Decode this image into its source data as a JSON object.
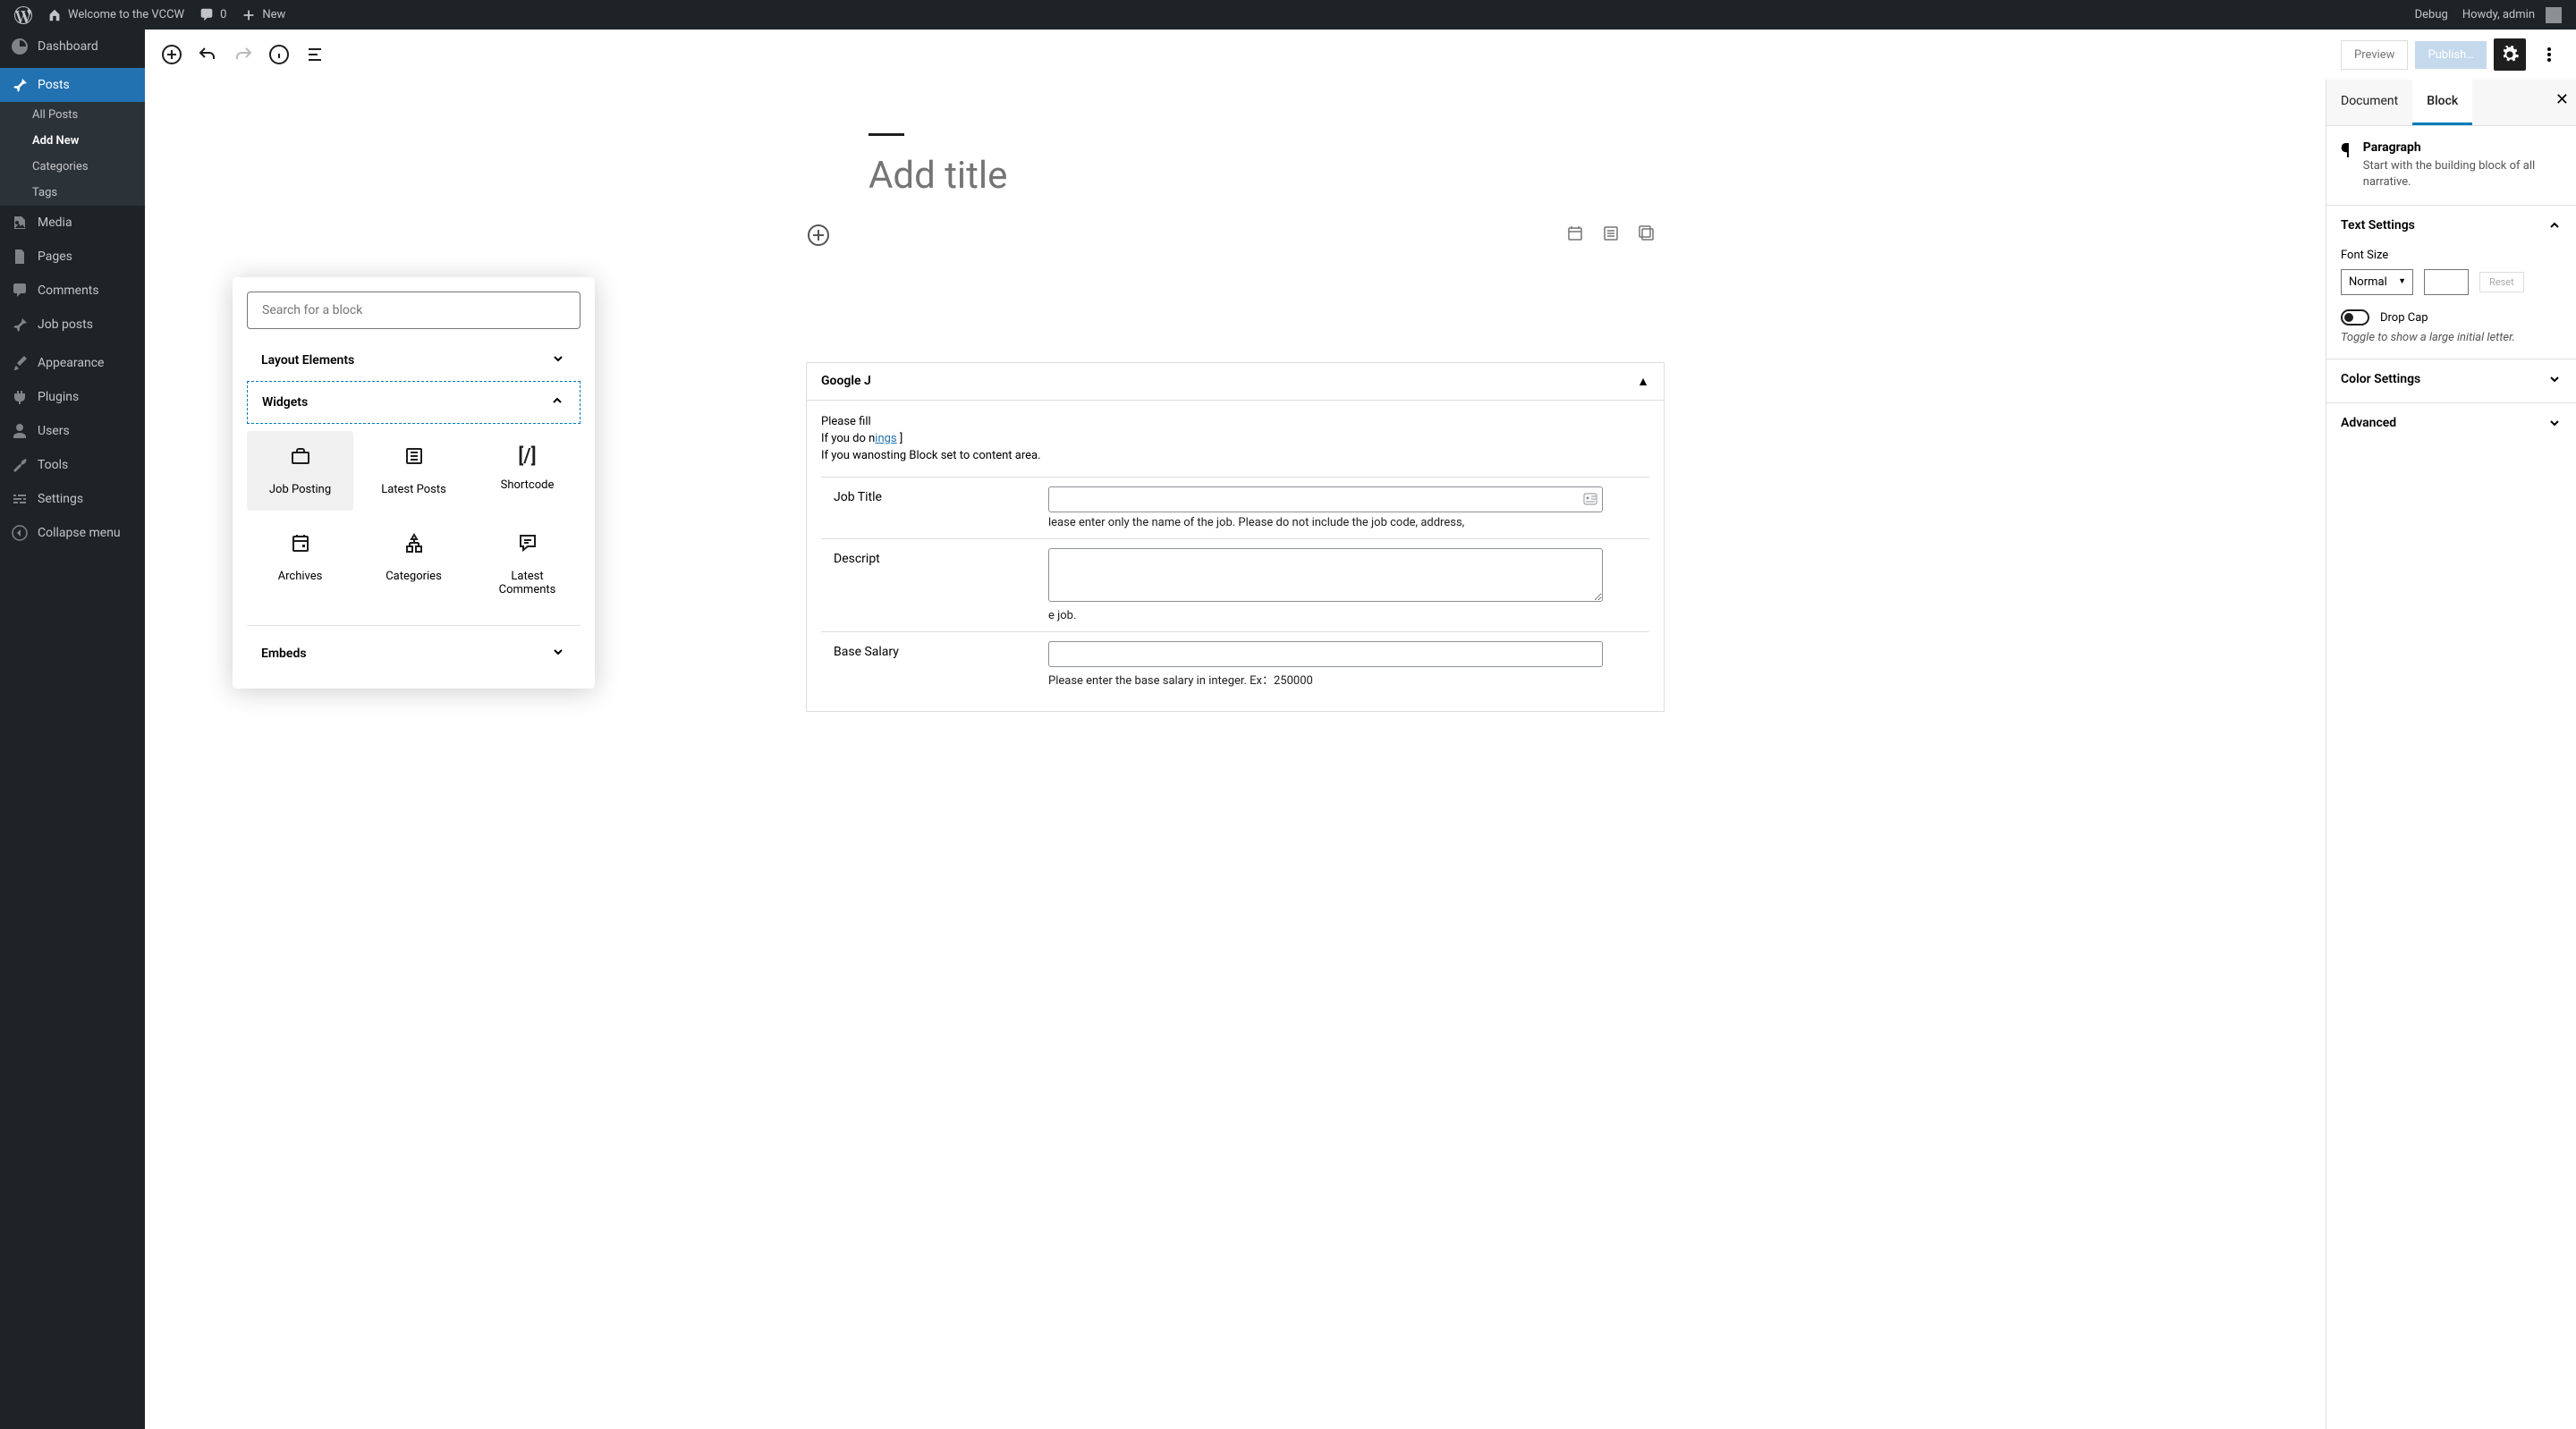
{
  "adminBar": {
    "siteName": "Welcome to the VCCW",
    "commentCount": "0",
    "new": "New",
    "debug": "Debug",
    "greeting": "Howdy, admin"
  },
  "sidebar": {
    "dashboard": "Dashboard",
    "posts": "Posts",
    "allPosts": "All Posts",
    "addNew": "Add New",
    "categories": "Categories",
    "tags": "Tags",
    "media": "Media",
    "pages": "Pages",
    "comments": "Comments",
    "jobPosts": "Job posts",
    "appearance": "Appearance",
    "plugins": "Plugins",
    "users": "Users",
    "tools": "Tools",
    "settings": "Settings",
    "collapse": "Collapse menu"
  },
  "toolbar": {
    "preview": "Preview",
    "publish": "Publish…"
  },
  "editor": {
    "titlePlaceholder": "Add title"
  },
  "inserter": {
    "searchPlaceholder": "Search for a block",
    "catLayout": "Layout Elements",
    "catWidgets": "Widgets",
    "catEmbeds": "Embeds",
    "blocks": {
      "jobPosting": "Job Posting",
      "latestPosts": "Latest Posts",
      "shortcode": "Shortcode",
      "archives": "Archives",
      "categories": "Categories",
      "latestComments": "Latest Comments"
    }
  },
  "metabox": {
    "title": "Google J",
    "p1": "Please fill",
    "p2a": "If you do n",
    "p2link": "ings",
    "p2b": " ]",
    "p3": "If you wan",
    "p3b": "osting Block set to content area.",
    "jobTitle": "Job Title",
    "jobTitleHint": "lease enter only the name of the job. Please do not include the job code, address,",
    "description": "Descript",
    "descriptionHint": "e job.",
    "baseSalary": "Base Salary",
    "baseSalaryHint": "Please enter the base salary in integer. Ex：250000"
  },
  "panel": {
    "tabDocument": "Document",
    "tabBlock": "Block",
    "blockName": "Paragraph",
    "blockDesc": "Start with the building block of all narrative.",
    "textSettings": "Text Settings",
    "fontSize": "Font Size",
    "fontSizeValue": "Normal",
    "reset": "Reset",
    "dropCap": "Drop Cap",
    "dropCapHint": "Toggle to show a large initial letter.",
    "colorSettings": "Color Settings",
    "advanced": "Advanced"
  }
}
